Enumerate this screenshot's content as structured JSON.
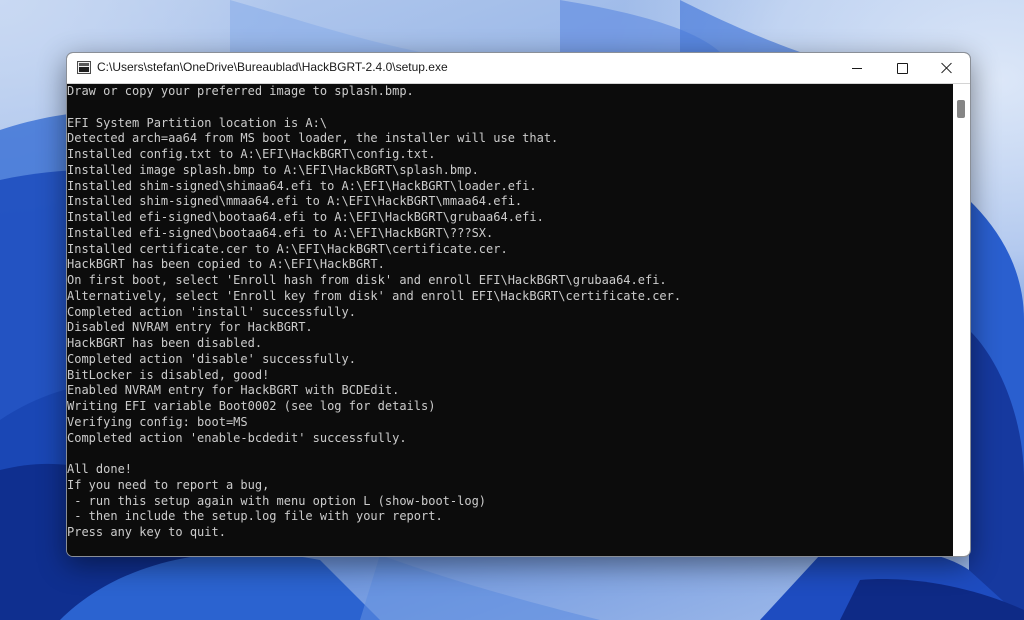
{
  "window": {
    "title": "C:\\Users\\stefan\\OneDrive\\Bureaublad\\HackBGRT-2.4.0\\setup.exe",
    "app_icon": "console-app-icon",
    "buttons": {
      "minimize_icon": "minimize-icon",
      "maximize_icon": "maximize-icon",
      "close_icon": "close-icon"
    }
  },
  "console": {
    "background": "#0c0c0c",
    "text_color": "#cccccc",
    "lines": [
      "Draw or copy your preferred image to splash.bmp.",
      "",
      "EFI System Partition location is A:\\",
      "Detected arch=aa64 from MS boot loader, the installer will use that.",
      "Installed config.txt to A:\\EFI\\HackBGRT\\config.txt.",
      "Installed image splash.bmp to A:\\EFI\\HackBGRT\\splash.bmp.",
      "Installed shim-signed\\shimaa64.efi to A:\\EFI\\HackBGRT\\loader.efi.",
      "Installed shim-signed\\mmaa64.efi to A:\\EFI\\HackBGRT\\mmaa64.efi.",
      "Installed efi-signed\\bootaa64.efi to A:\\EFI\\HackBGRT\\grubaa64.efi.",
      "Installed efi-signed\\bootaa64.efi to A:\\EFI\\HackBGRT\\???SX.",
      "Installed certificate.cer to A:\\EFI\\HackBGRT\\certificate.cer.",
      "HackBGRT has been copied to A:\\EFI\\HackBGRT.",
      "On first boot, select 'Enroll hash from disk' and enroll EFI\\HackBGRT\\grubaa64.efi.",
      "Alternatively, select 'Enroll key from disk' and enroll EFI\\HackBGRT\\certificate.cer.",
      "Completed action 'install' successfully.",
      "Disabled NVRAM entry for HackBGRT.",
      "HackBGRT has been disabled.",
      "Completed action 'disable' successfully.",
      "BitLocker is disabled, good!",
      "Enabled NVRAM entry for HackBGRT with BCDEdit.",
      "Writing EFI variable Boot0002 (see log for details)",
      "Verifying config: boot=MS",
      "Completed action 'enable-bcdedit' successfully.",
      "",
      "All done!",
      "If you need to report a bug,",
      " - run this setup again with menu option L (show-boot-log)",
      " - then include the setup.log file with your report.",
      "Press any key to quit."
    ]
  }
}
